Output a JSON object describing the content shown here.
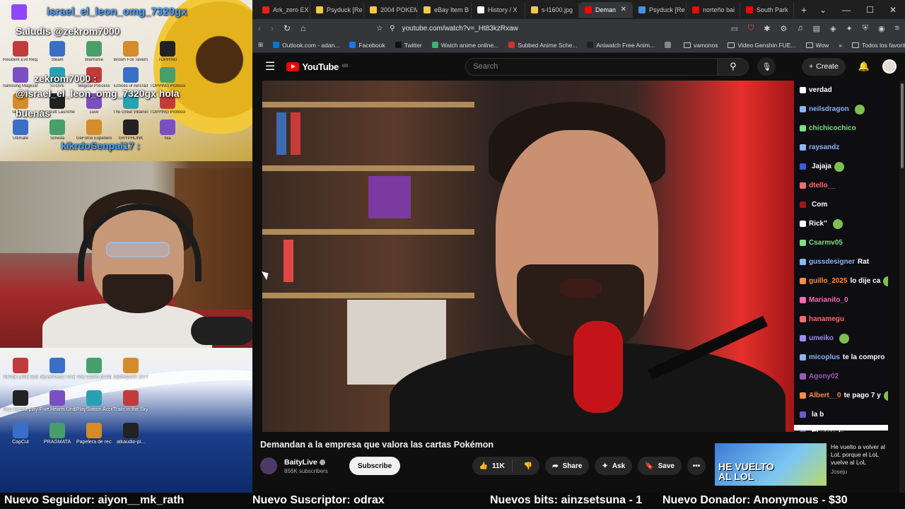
{
  "overlay": {
    "chat_lines": [
      {
        "user": "israel_el_leon_omg_7320gx",
        "text": ""
      },
      {
        "user": "",
        "text": "Saludis @zekrom7000"
      },
      {
        "user": "zekrom7000",
        "text": ":"
      },
      {
        "user": "",
        "text": "@israel_el_leon_omg_7320gx hola"
      },
      {
        "user": "",
        "text": "buenas"
      },
      {
        "user": "kikrdoSenpai17",
        "text": ":"
      }
    ],
    "desktop_icons_top": [
      "Resident Evil Requiem",
      "Steam",
      "Warframe",
      "Brown Fox Tavern",
      "TOPPING",
      "Samsung Magician",
      "STOVE",
      "Magical Princess",
      "Echoes of Aincrad",
      "TOPPING Professio...",
      "Tangy TD",
      "Minecraft Launcher",
      "cave",
      "The Great Villainess",
      "TOPPING Professio...",
      "Ultimate",
      "Scheda",
      "GeForce Experience",
      "GRYPHLINK",
      "Isla"
    ],
    "desktop_icons_bottom": [
      "TikTok LIVE Studio",
      "Nevermess To Evermess",
      "The Coffin of Andy and L...",
      "Cyberpunk 2077",
      "VLC media player",
      "Five Hearts Under O...",
      "PlayStation Accessories",
      "Trails in the Sky 1st Ch...",
      "CapCut",
      "PRAGMATA",
      "Papelera de reciclaje",
      "atkaudio-pl..."
    ]
  },
  "browser": {
    "tabs": [
      {
        "label": "Ark_zero EX",
        "color": "#e62117",
        "active": false
      },
      {
        "label": "Psyduck [Re",
        "color": "#f2c94c",
        "active": false
      },
      {
        "label": "2004 POKEM",
        "color": "#f2c94c",
        "active": false
      },
      {
        "label": "eBay Item B",
        "color": "#f2c94c",
        "active": false
      },
      {
        "label": "History / X",
        "color": "#ffffff",
        "active": false
      },
      {
        "label": "s-l1600.jpg",
        "color": "#f2c94c",
        "active": false
      },
      {
        "label": "Deman",
        "color": "#ff0000",
        "active": true
      },
      {
        "label": "Psyduck [Re",
        "color": "#4a90e2",
        "active": false
      },
      {
        "label": "norteño bai",
        "color": "#ff0000",
        "active": false
      },
      {
        "label": "South Park",
        "color": "#ff0000",
        "active": false
      }
    ],
    "new_tab": "+",
    "url": "youtube.com/watch?v=_Ht83kzRxaw",
    "bookmarks": [
      {
        "label": "Outlook.com - adan...",
        "color": "#0078d4",
        "type": "site"
      },
      {
        "label": "Facebook",
        "color": "#1877f2",
        "type": "site"
      },
      {
        "label": "Twitter",
        "color": "#111111",
        "type": "site"
      },
      {
        "label": "Watch anime online...",
        "color": "#3cb371",
        "type": "site"
      },
      {
        "label": "Subbed Anime Sche...",
        "color": "#d32f2f",
        "type": "site"
      },
      {
        "label": "Aniwatch Free Anim...",
        "color": "#222222",
        "type": "site"
      },
      {
        "label": "",
        "color": "#888888",
        "type": "site"
      },
      {
        "label": "vamonos",
        "color": "",
        "type": "folder"
      },
      {
        "label": "Video Genshin FUE...",
        "color": "",
        "type": "folder"
      },
      {
        "label": "Wow",
        "color": "",
        "type": "folder"
      }
    ],
    "bookmarks_more": "»",
    "all_bookmarks": "Todos los favoritos"
  },
  "youtube": {
    "logo_text": "YouTube",
    "region": "MX",
    "search_placeholder": "Search",
    "create_label": "Create",
    "video_title": "Demandan a la empresa que valora las cartas Pokémon",
    "channel_name": "BaityLive",
    "subscribers": "856K subscribers",
    "subscribe_label": "Subscribe",
    "likes": "11K",
    "share_label": "Share",
    "ask_label": "Ask",
    "save_label": "Save",
    "more_label": "•••",
    "live_chat": [
      {
        "user": "verdad",
        "color": "#ffffff",
        "msg": ""
      },
      {
        "user": "neilsdragon",
        "color": "#8ab4f8",
        "msg": ""
      },
      {
        "user": "chichicochico",
        "color": "#7ee081",
        "msg": ""
      },
      {
        "user": "raysandz",
        "color": "#8ab4f8",
        "msg": ""
      },
      {
        "user": "",
        "color": "#3b5bdb",
        "msg": "Jajaja"
      },
      {
        "user": "dtello__",
        "color": "#ff6b6b",
        "msg": ""
      },
      {
        "user": "",
        "color": "#a31515",
        "msg": "Com"
      },
      {
        "user": "Rick\"",
        "color": "#ffffff",
        "msg": ""
      },
      {
        "user": "Csarmv05",
        "color": "#7ee081",
        "msg": ""
      },
      {
        "user": "gussdesigner",
        "color": "#8ab4f8",
        "msg": "Rat"
      },
      {
        "user": "guillo_2025",
        "color": "#ff8c42",
        "msg": "lo dije ca"
      },
      {
        "user": "Marianito_0",
        "color": "#ff69b4",
        "msg": ""
      },
      {
        "user": "hanamegu",
        "color": "#ff6b6b",
        "msg": ""
      },
      {
        "user": "umeiko",
        "color": "#9b8cf7",
        "msg": ""
      },
      {
        "user": "micoplus",
        "color": "#8ab4f8",
        "msg": "te la compro"
      },
      {
        "user": "Agony02",
        "color": "#9b59b6",
        "msg": ""
      },
      {
        "user": "Albert__0",
        "color": "#ff8c42",
        "msg": "te pago 7 y"
      },
      {
        "user": "",
        "color": "#6a5acd",
        "msg": "la b"
      },
      {
        "user": "",
        "color": "#3b5bdb",
        "msg": "El viejo tr"
      }
    ],
    "recommendation": {
      "thumb_text_1": "HE VUELTO",
      "thumb_text_2": "AL LOL",
      "title": "He vuelto a volver al LoL porque el LoL vuelve al LoL",
      "channel": "Joseju"
    }
  },
  "alerts": {
    "follower": "Nuevo Seguidor: aiyon__mk_rath",
    "subscriber": "Nuevo Suscriptor: odrax",
    "bits": "Nuevos bits: ainzsetsuna - 1",
    "donor": "Nuevo Donador: Anonymous - $30"
  }
}
